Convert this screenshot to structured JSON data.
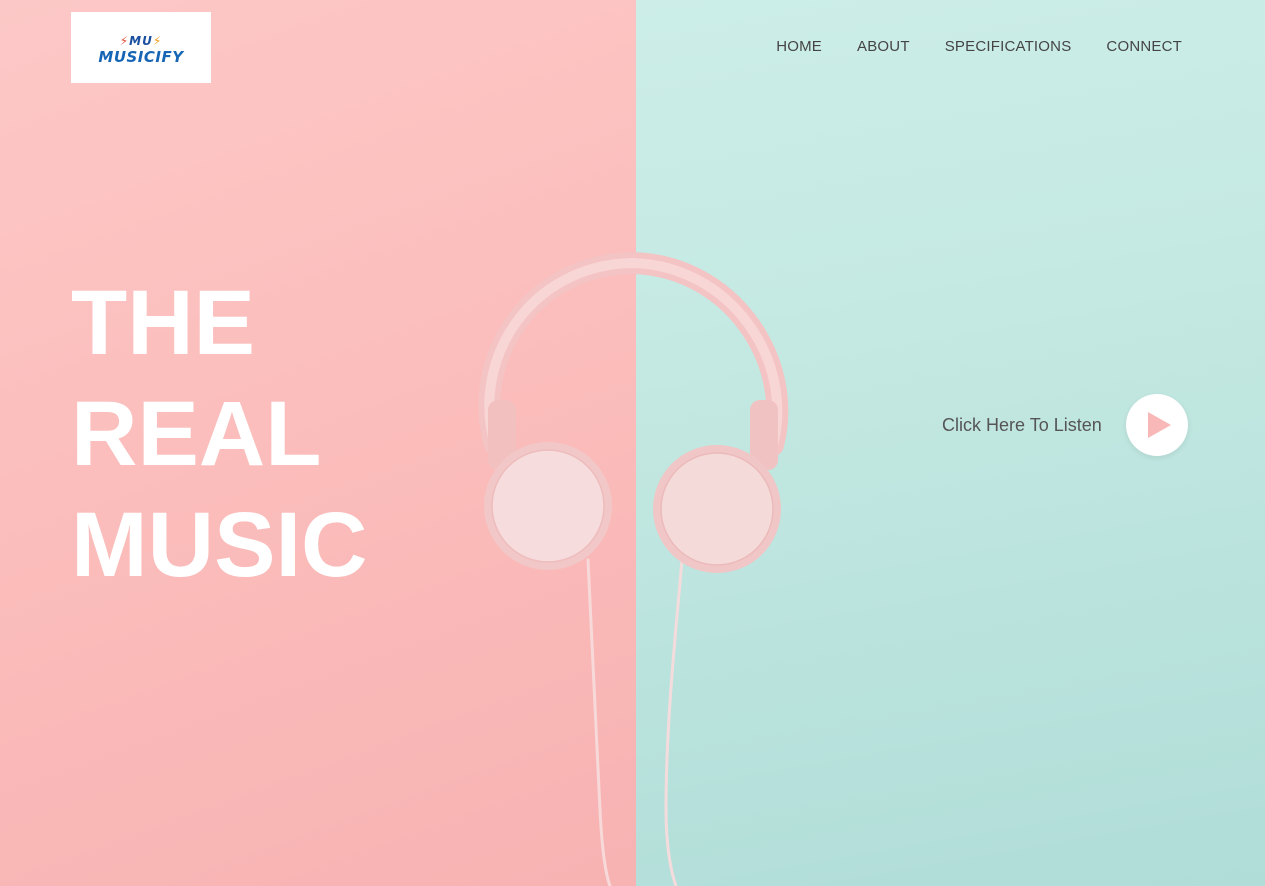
{
  "brand": {
    "logo_mark": "MU",
    "logo_text": "MUSICIFY",
    "colors": {
      "blue": "#1766b5",
      "red": "#e0523a",
      "orange": "#f0a020"
    }
  },
  "nav": {
    "items": [
      {
        "label": "HOME"
      },
      {
        "label": "ABOUT"
      },
      {
        "label": "SPECIFICATIONS"
      },
      {
        "label": "CONNECT"
      }
    ]
  },
  "hero": {
    "headline_lines": [
      "THE",
      "REAL",
      "MUSIC"
    ],
    "image": "headphones-icon",
    "colors": {
      "left_bg": "#fbbdbb",
      "right_bg": "#c2e7e1",
      "text": "#ffffff"
    }
  },
  "cta": {
    "label": "Click Here To Listen",
    "icon": "play-icon",
    "icon_color": "#f9b8b8"
  }
}
